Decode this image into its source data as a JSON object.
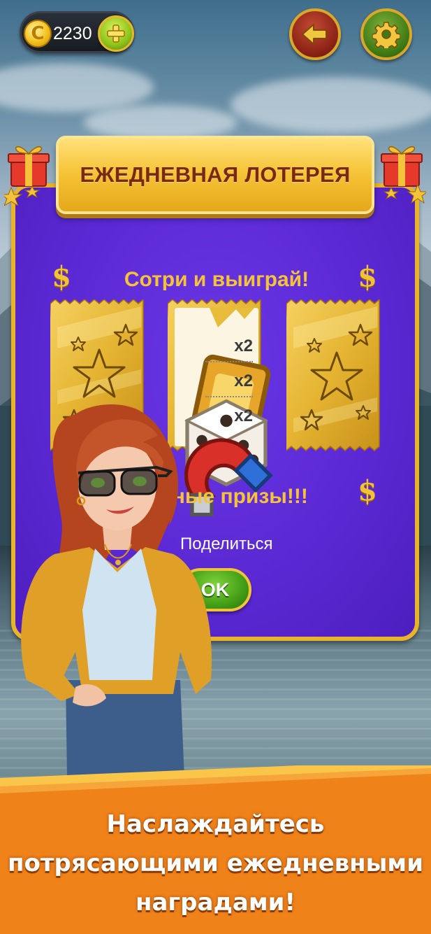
{
  "header": {
    "coin_count": "2230",
    "coin_symbol": "C",
    "icons": {
      "coin": "coin-icon",
      "add": "plus-icon",
      "back": "arrow-left-icon",
      "settings": "gear-icon"
    }
  },
  "dialog": {
    "title": "ЕЖЕДНЕВНАЯ ЛОТЕРЕЯ",
    "subtitle": "Сотри и выиграй!",
    "prizes_text_visible": "тные призы!!!",
    "dollar_symbol": "$",
    "tickets": [
      {
        "state": "scratch",
        "icon": "star-icon"
      },
      {
        "state": "revealed",
        "prizes": [
          {
            "icon": "golden-ticket-icon",
            "qty": "x2"
          },
          {
            "icon": "dice-icon",
            "qty": "x2"
          },
          {
            "icon": "magnet-icon",
            "qty": "x2"
          }
        ]
      },
      {
        "state": "scratch",
        "icon": "star-icon"
      }
    ],
    "share_label": "Поделиться",
    "ok_label": "OK"
  },
  "promo": {
    "line1": "Наслаждайтесь",
    "line2": "потрясающими ежедневными",
    "line3": "наградами!"
  },
  "colors": {
    "panel_purple": "#5d2cd8",
    "gold": "#f5c33a",
    "title_text": "#7a2a14",
    "banner_orange": "#f0821a"
  }
}
